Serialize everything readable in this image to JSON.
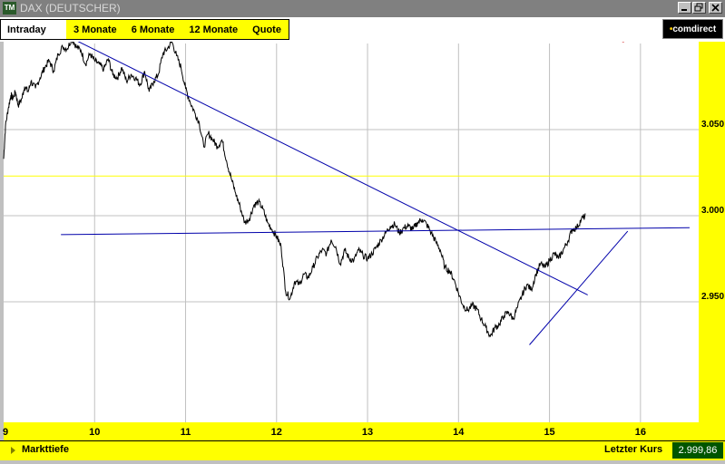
{
  "window": {
    "title": "DAX (DEUTSCHER)",
    "app_icon": "TM",
    "controls": [
      "minimize-icon",
      "restore-icon",
      "close-icon"
    ]
  },
  "tabs": [
    {
      "label": "Intraday",
      "active": true
    },
    {
      "label": "3 Monate",
      "active": false
    },
    {
      "label": "6 Monate",
      "active": false
    },
    {
      "label": "12 Monate",
      "active": false
    },
    {
      "label": "Quote",
      "active": false
    }
  ],
  "brand": {
    "dot": "•",
    "name": "comdirect"
  },
  "colors": {
    "price_line": "#000000",
    "trend_lines": "#0000aa",
    "reference_line": "#ffff00",
    "last_segment": "#cc0000",
    "axis_panel": "#ffff00",
    "grid": "#c0c0c0"
  },
  "chart_data": {
    "type": "line",
    "title": "",
    "xlabel": "",
    "ylabel": "",
    "x_ticks": [
      "9",
      "10",
      "11",
      "12",
      "13",
      "14",
      "15",
      "16"
    ],
    "x_range": [
      9,
      16.64
    ],
    "y_ticks": [
      "3.050",
      "3.000",
      "2.950"
    ],
    "y_tick_values": [
      3050,
      3000,
      2950
    ],
    "y_range": [
      2880,
      3100
    ],
    "grid": true,
    "series": [
      {
        "values_x": [
          9.0,
          9.02,
          9.05,
          9.08,
          9.1,
          9.13,
          9.16,
          9.2,
          9.23,
          9.27,
          9.3,
          9.35,
          9.4,
          9.45,
          9.5,
          9.55,
          9.6,
          9.65,
          9.7,
          9.75,
          9.8,
          9.85,
          9.9,
          9.95,
          10.0,
          10.05,
          10.1,
          10.15,
          10.2,
          10.25,
          10.3,
          10.35,
          10.4,
          10.45,
          10.5,
          10.55,
          10.6,
          10.65,
          10.7,
          10.75,
          10.8,
          10.85,
          10.9,
          10.95,
          11.0,
          11.05,
          11.1,
          11.15,
          11.2,
          11.25,
          11.3,
          11.35,
          11.4,
          11.45,
          11.5,
          11.55,
          11.6,
          11.65,
          11.7,
          11.75,
          11.8,
          11.85,
          11.9,
          11.95,
          12.0,
          12.05,
          12.1,
          12.15,
          12.2,
          12.25,
          12.3,
          12.35,
          12.4,
          12.45,
          12.5,
          12.55,
          12.6,
          12.65,
          12.7,
          12.75,
          12.8,
          12.85,
          12.9,
          12.95,
          13.0,
          13.05,
          13.1,
          13.15,
          13.2,
          13.25,
          13.3,
          13.35,
          13.4,
          13.45,
          13.5,
          13.55,
          13.6,
          13.65,
          13.7,
          13.75,
          13.8,
          13.85,
          13.9,
          13.95,
          14.0,
          14.05,
          14.1,
          14.15,
          14.2,
          14.25,
          14.3,
          14.35,
          14.4,
          14.45,
          14.5,
          14.55,
          14.6,
          14.65,
          14.7,
          14.75,
          14.8,
          14.85,
          14.9,
          14.95,
          15.0,
          15.05,
          15.1,
          15.15,
          15.2,
          15.25,
          15.3,
          15.35,
          15.4,
          15.45,
          15.5,
          15.55,
          15.6,
          15.65,
          15.7,
          15.75,
          15.8,
          15.82
        ],
        "values_y": [
          3033,
          3052,
          3062,
          3070,
          3068,
          3072,
          3064,
          3068,
          3075,
          3072,
          3078,
          3074,
          3080,
          3086,
          3090,
          3084,
          3094,
          3098,
          3097,
          3103,
          3098,
          3096,
          3088,
          3094,
          3090,
          3088,
          3085,
          3091,
          3082,
          3080,
          3086,
          3078,
          3082,
          3080,
          3076,
          3084,
          3072,
          3078,
          3082,
          3094,
          3097,
          3101,
          3093,
          3086,
          3074,
          3066,
          3060,
          3054,
          3040,
          3048,
          3044,
          3040,
          3044,
          3032,
          3022,
          3013,
          3005,
          2996,
          2998,
          3006,
          3008,
          3004,
          2996,
          2992,
          2988,
          2982,
          2956,
          2952,
          2962,
          2960,
          2966,
          2964,
          2970,
          2976,
          2980,
          2978,
          2986,
          2982,
          2972,
          2980,
          2975,
          2974,
          2980,
          2977,
          2975,
          2978,
          2982,
          2986,
          2990,
          2994,
          2995,
          2990,
          2993,
          2994,
          2992,
          2996,
          2998,
          2995,
          2990,
          2985,
          2980,
          2970,
          2968,
          2963,
          2955,
          2948,
          2945,
          2948,
          2946,
          2940,
          2935,
          2930,
          2935,
          2937,
          2942,
          2944,
          2940,
          2947,
          2954,
          2960,
          2957,
          2966,
          2972,
          2970,
          2974,
          2978,
          2975,
          2980,
          2985,
          2992,
          2993,
          2998,
          3000
        ],
        "markers": []
      }
    ],
    "trend_lines": [
      {
        "from": [
          9.75,
          3103
        ],
        "to": [
          15.42,
          2954
        ]
      },
      {
        "from": [
          14.78,
          2925
        ],
        "to": [
          15.86,
          2991
        ]
      },
      {
        "from": [
          9.63,
          2989
        ],
        "to": [
          16.54,
          2993
        ]
      }
    ],
    "reference_line": 3023,
    "last_value": 3000
  },
  "bottom": {
    "markttiefe": "Markttiefe",
    "last_label": "Letzter Kurs",
    "last_value": "2.999,86"
  }
}
